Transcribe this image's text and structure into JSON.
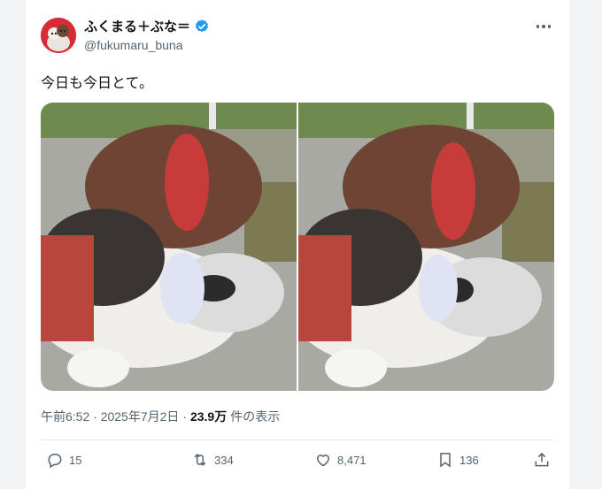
{
  "tweet": {
    "author": {
      "display_name": "ふくまる＋ぶな＝",
      "handle": "@fukumaru_buna"
    },
    "text": "今日も今日とて。",
    "timestamp": "午前6:52 · 2025年7月2日 · ",
    "views": {
      "count": "23.9万",
      "label": "件の表示"
    },
    "actions": {
      "replies": "15",
      "retweets": "334",
      "likes": "8,471",
      "bookmarks": "136"
    }
  },
  "colors": {
    "verified": "#1d9bf0",
    "secondary_text": "#536471",
    "avatar_bg": "#d72b36"
  },
  "icons": [
    "verified-badge-icon",
    "more-icon",
    "reply-icon",
    "retweet-icon",
    "like-icon",
    "bookmark-icon",
    "share-icon"
  ]
}
